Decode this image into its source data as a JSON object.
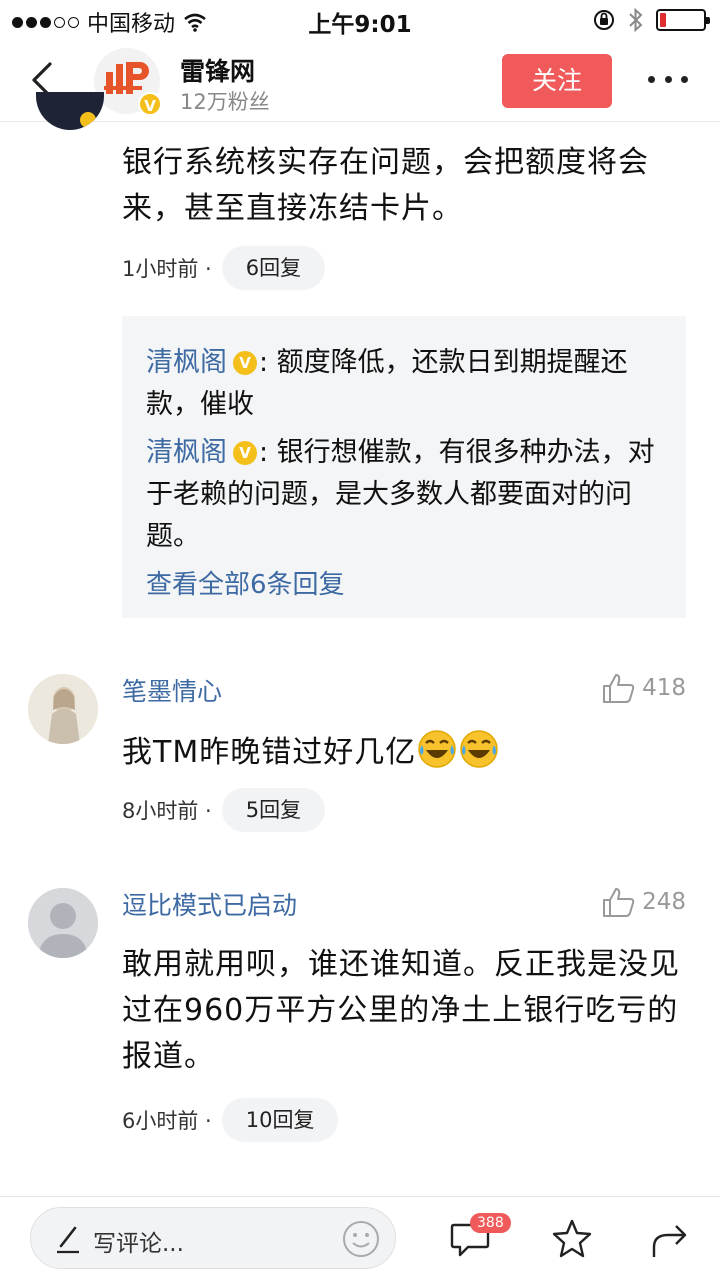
{
  "status_bar": {
    "carrier": "中国移动",
    "time": "上午9:01",
    "battery_level": 0.15,
    "battery_color": "#e02e2e"
  },
  "header": {
    "title": "雷锋网",
    "subtitle": "12万粉丝",
    "follow_label": "关注",
    "verified_mark": "V",
    "accent": "#f05a5a"
  },
  "comments": [
    {
      "text": "银行系统核实存在问题，会把额度将会来，甚至直接冻结卡片。",
      "time": "1小时前 ·",
      "replies_label": "6回复",
      "replies": [
        {
          "user": "清枫阁",
          "badge": "V",
          "text": ": 额度降低，还款日到期提醒还款，催收"
        },
        {
          "user": "清枫阁",
          "badge": "V",
          "text": ": 银行想催款，有很多种办法，对于老赖的问题，是大多数人都要面对的问题。"
        }
      ],
      "view_all": "查看全部6条回复"
    },
    {
      "user": "笔墨情心",
      "likes": "418",
      "text": "我TM昨晚错过好几亿",
      "time": "8小时前 ·",
      "replies_label": "5回复"
    },
    {
      "user": "逗比模式已启动",
      "likes": "248",
      "text": "敢用就用呗，谁还谁知道。反正我是没见过在960万平方公里的净土上银行吃亏的报道。",
      "time": "6小时前 ·",
      "replies_label": "10回复"
    }
  ],
  "bottom_bar": {
    "placeholder": "写评论...",
    "comment_count": "388"
  },
  "link_color": "#3e6aa3"
}
